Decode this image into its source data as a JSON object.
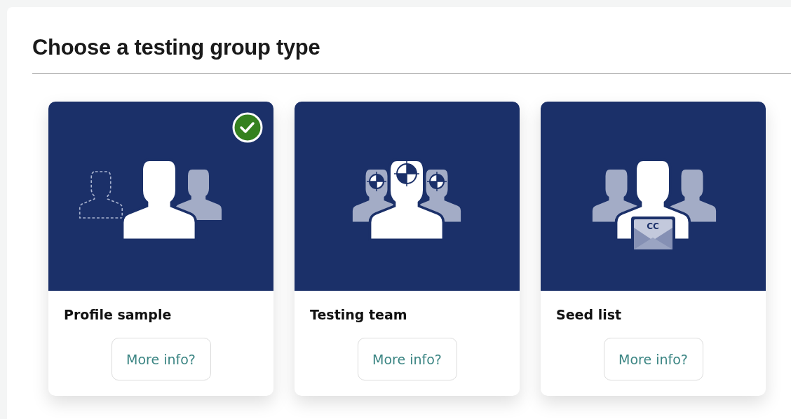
{
  "heading": "Choose a testing group type",
  "cards": [
    {
      "kind": "profile",
      "title": "Profile sample",
      "selected": true,
      "button": "More info?"
    },
    {
      "kind": "team",
      "title": "Testing team",
      "selected": false,
      "button": "More info?"
    },
    {
      "kind": "seed",
      "title": "Seed list",
      "selected": false,
      "button": "More info?",
      "envelope_label": "CC"
    }
  ]
}
